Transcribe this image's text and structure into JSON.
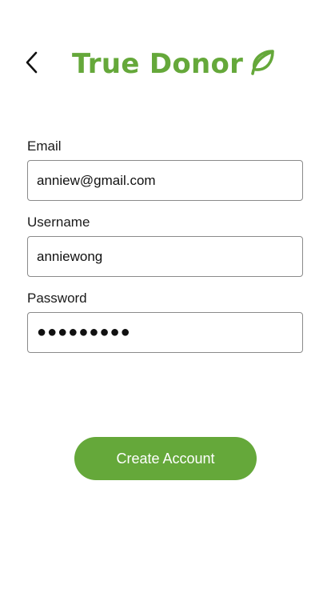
{
  "header": {
    "brand_name": "True Donor",
    "back_icon": "chevron-left-icon",
    "brand_icon": "leaf-icon"
  },
  "form": {
    "email": {
      "label": "Email",
      "value": "anniew@gmail.com"
    },
    "username": {
      "label": "Username",
      "value": "anniewong"
    },
    "password": {
      "label": "Password",
      "value": "●●●●●●●●●"
    }
  },
  "actions": {
    "create_account_label": "Create Account"
  },
  "colors": {
    "brand_green": "#65a83a",
    "text": "#1a1a1a",
    "border": "#8a8a8a"
  }
}
